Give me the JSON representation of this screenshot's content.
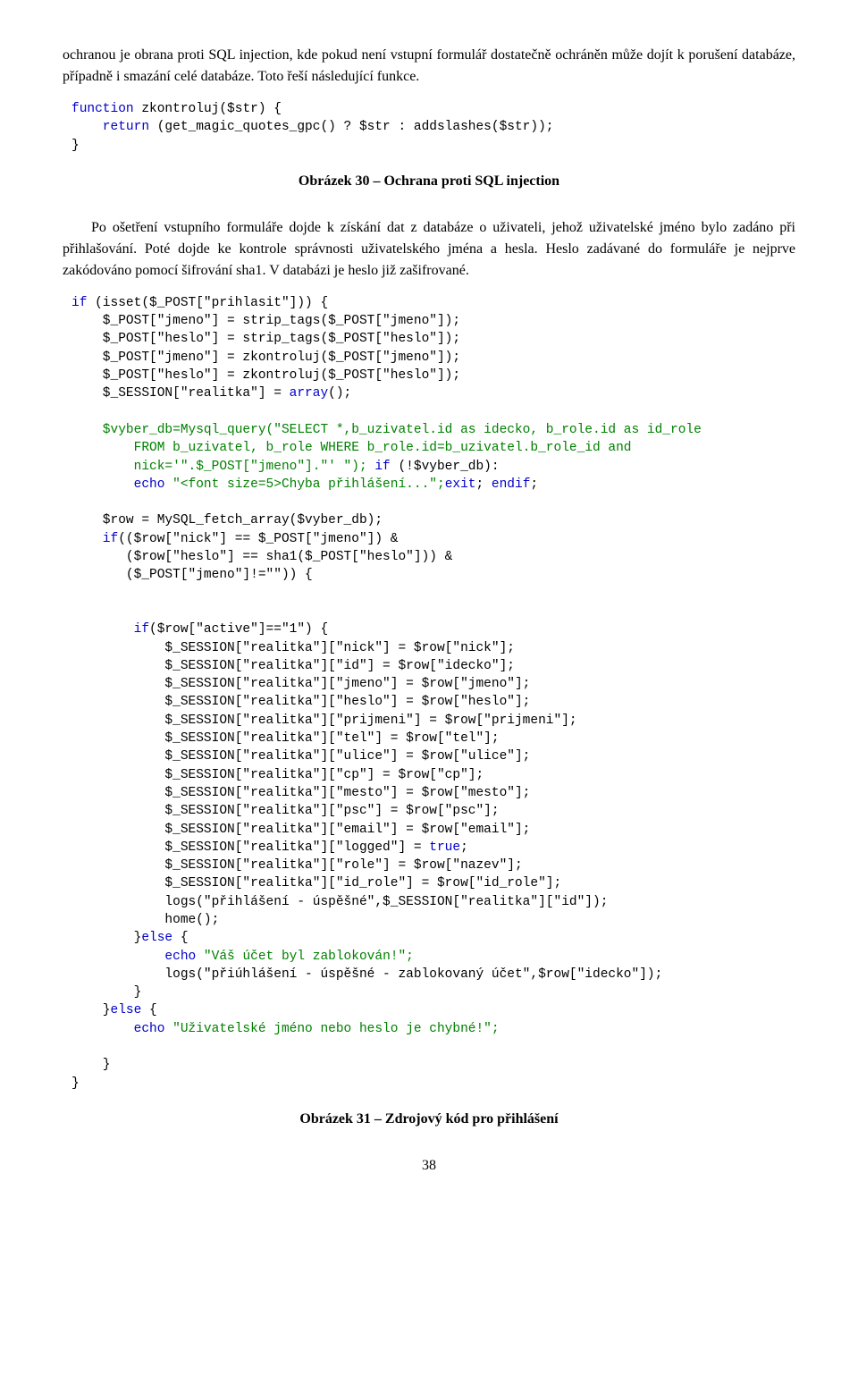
{
  "para1": "ochranou je obrana proti SQL injection, kde pokud není vstupní formulář dostatečně ochráněn může dojít k porušení databáze, případně i smazání celé databáze. Toto řeší následující funkce.",
  "code1": {
    "l1a": "function",
    "l1b": " zkontroluj($str) {",
    "l2a": "    return",
    "l2b": " (get_magic_quotes_gpc() ? $str : addslashes($str));",
    "l3": "}"
  },
  "caption1": "Obrázek 30 – Ochrana proti SQL injection",
  "para2": "Po ošetření vstupního formuláře dojde k získání dat z databáze o uživateli, jehož uživatelské jméno bylo zadáno při přihlašování. Poté dojde ke kontrole správnosti uživatelského jména a hesla. Heslo zadávané do formuláře je nejprve zakódováno pomocí šifrování sha1. V databázi je heslo již zašifrované.",
  "code2": {
    "l1a": "if",
    "l1b": " (isset($_POST[\"prihlasit\"])) {",
    "l2": "    $_POST[\"jmeno\"] = strip_tags($_POST[\"jmeno\"]);",
    "l3": "    $_POST[\"heslo\"] = strip_tags($_POST[\"heslo\"]);",
    "l4": "    $_POST[\"jmeno\"] = zkontroluj($_POST[\"jmeno\"]);",
    "l5": "    $_POST[\"heslo\"] = zkontroluj($_POST[\"heslo\"]);",
    "l6a": "    $_SESSION[\"realitka\"] = ",
    "l6b": "array",
    "l6c": "();",
    "blank1": " ",
    "l7": "    $vyber_db=Mysql_query(\"SELECT *,b_uzivatel.id as idecko, b_role.id as id_role",
    "l8": "        FROM b_uzivatel, b_role WHERE b_role.id=b_uzivatel.b_role_id and",
    "l9a": "        nick='\".$_POST[\"jmeno\"].\"' \"); ",
    "l9b": "if",
    "l9c": " (!$vyber_db):",
    "l10a": "        echo",
    "l10b": " \"<font size=5>Chyba přihlášení...\";",
    "l10c": "exit",
    "l10d": "; ",
    "l10e": "endif",
    "l10f": ";",
    "blank2": " ",
    "l11": "    $row = MySQL_fetch_array($vyber_db);",
    "l12a": "    if",
    "l12b": "(($row[\"nick\"] == $_POST[\"jmeno\"]) &",
    "l13": "       ($row[\"heslo\"] == sha1($_POST[\"heslo\"])) &",
    "l14": "       ($_POST[\"jmeno\"]!=\"\")) {",
    "blank3": " ",
    "blank4": " ",
    "l15a": "        if",
    "l15b": "($row[\"active\"]==\"1\") {",
    "l16": "            $_SESSION[\"realitka\"][\"nick\"] = $row[\"nick\"];",
    "l17": "            $_SESSION[\"realitka\"][\"id\"] = $row[\"idecko\"];",
    "l18": "            $_SESSION[\"realitka\"][\"jmeno\"] = $row[\"jmeno\"];",
    "l19": "            $_SESSION[\"realitka\"][\"heslo\"] = $row[\"heslo\"];",
    "l20": "            $_SESSION[\"realitka\"][\"prijmeni\"] = $row[\"prijmeni\"];",
    "l21": "            $_SESSION[\"realitka\"][\"tel\"] = $row[\"tel\"];",
    "l22": "            $_SESSION[\"realitka\"][\"ulice\"] = $row[\"ulice\"];",
    "l23": "            $_SESSION[\"realitka\"][\"cp\"] = $row[\"cp\"];",
    "l24": "            $_SESSION[\"realitka\"][\"mesto\"] = $row[\"mesto\"];",
    "l25": "            $_SESSION[\"realitka\"][\"psc\"] = $row[\"psc\"];",
    "l26": "            $_SESSION[\"realitka\"][\"email\"] = $row[\"email\"];",
    "l27a": "            $_SESSION[\"realitka\"][\"logged\"] = ",
    "l27b": "true",
    "l27c": ";",
    "l28": "            $_SESSION[\"realitka\"][\"role\"] = $row[\"nazev\"];",
    "l29": "            $_SESSION[\"realitka\"][\"id_role\"] = $row[\"id_role\"];",
    "l30": "            logs(\"přihlášení - úspěšné\",$_SESSION[\"realitka\"][\"id\"]);",
    "l31": "            home();",
    "l32a": "        }",
    "l32b": "else",
    "l32c": " {",
    "l33a": "            echo",
    "l33b": " \"Váš účet byl zablokován!\";",
    "l34": "            logs(\"přiúhlášení - úspěšné - zablokovaný účet\",$row[\"idecko\"]);",
    "l35": "        }",
    "l36a": "    }",
    "l36b": "else",
    "l36c": " {",
    "l37a": "        echo",
    "l37b": " \"Uživatelské jméno nebo heslo je chybné!\";",
    "blank5": " ",
    "l38": "    }",
    "l39": "}"
  },
  "caption2": "Obrázek 31 – Zdrojový kód pro přihlášení",
  "pagenum": "38"
}
